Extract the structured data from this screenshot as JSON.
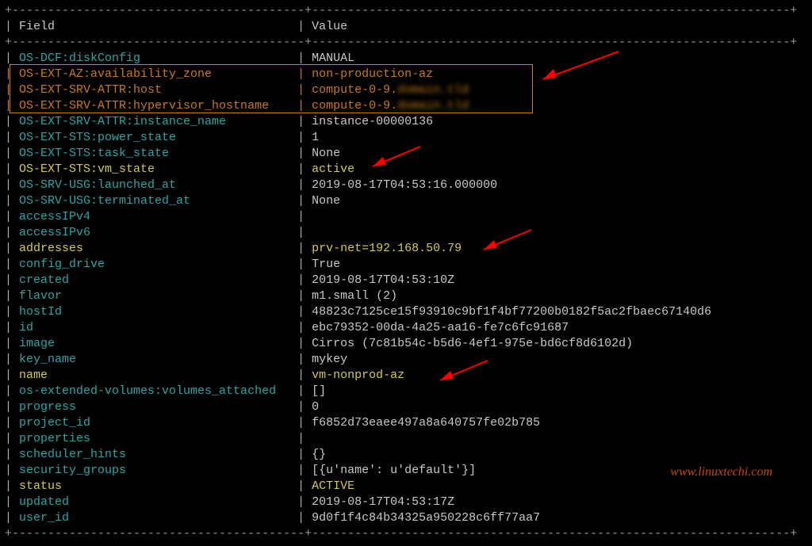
{
  "header": {
    "field_label": "Field",
    "value_label": "Value"
  },
  "border": {
    "dash_left": "-----------------------------------------",
    "dash_right": "-------------------------------------------------------------------"
  },
  "watermark": "www.linuxtechi.com",
  "rows": [
    {
      "field": "OS-DCF:diskConfig",
      "value": "MANUAL"
    },
    {
      "field": "OS-EXT-AZ:availability_zone",
      "value": "non-production-az",
      "hl": true
    },
    {
      "field": "OS-EXT-SRV-ATTR:host",
      "value": "compute-0-9.",
      "suffix_blur": "domain.tld",
      "hl": true
    },
    {
      "field": "OS-EXT-SRV-ATTR:hypervisor_hostname",
      "value": "compute-0-9.",
      "suffix_blur": "domain.tld",
      "hl": true
    },
    {
      "field": "OS-EXT-SRV-ATTR:instance_name",
      "value": "instance-00000136"
    },
    {
      "field": "OS-EXT-STS:power_state",
      "value": "1"
    },
    {
      "field": "OS-EXT-STS:task_state",
      "value": "None"
    },
    {
      "field": "OS-EXT-STS:vm_state",
      "value": "active",
      "yellow": true
    },
    {
      "field": "OS-SRV-USG:launched_at",
      "value": "2019-08-17T04:53:16.000000"
    },
    {
      "field": "OS-SRV-USG:terminated_at",
      "value": "None"
    },
    {
      "field": "accessIPv4",
      "value": ""
    },
    {
      "field": "accessIPv6",
      "value": ""
    },
    {
      "field": "addresses",
      "value": "prv-net=192.168.50.79",
      "yellow": true
    },
    {
      "field": "config_drive",
      "value": "True"
    },
    {
      "field": "created",
      "value": "2019-08-17T04:53:10Z"
    },
    {
      "field": "flavor",
      "value": "m1.small (2)"
    },
    {
      "field": "hostId",
      "value": "48823c7125ce15f93910c9bf1f4bf77200b0182f5ac2fbaec67140d6"
    },
    {
      "field": "id",
      "value": "ebc79352-00da-4a25-aa16-fe7c6fc91687"
    },
    {
      "field": "image",
      "value": "Cirros (7c81b54c-b5d6-4ef1-975e-bd6cf8d6102d)"
    },
    {
      "field": "key_name",
      "value": "mykey"
    },
    {
      "field": "name",
      "value": "vm-nonprod-az",
      "yellow": true
    },
    {
      "field": "os-extended-volumes:volumes_attached",
      "value": "[]"
    },
    {
      "field": "progress",
      "value": "0"
    },
    {
      "field": "project_id",
      "value": "f6852d73eaee497a8a640757fe02b785"
    },
    {
      "field": "properties",
      "value": ""
    },
    {
      "field": "scheduler_hints",
      "value": "{}"
    },
    {
      "field": "security_groups",
      "value": "[{u'name': u'default'}]"
    },
    {
      "field": "status",
      "value": "ACTIVE",
      "yellow": true
    },
    {
      "field": "updated",
      "value": "2019-08-17T04:53:17Z"
    },
    {
      "field": "user_id",
      "value": "9d0f1f4c84b34325a950228c6ff77aa7"
    }
  ]
}
